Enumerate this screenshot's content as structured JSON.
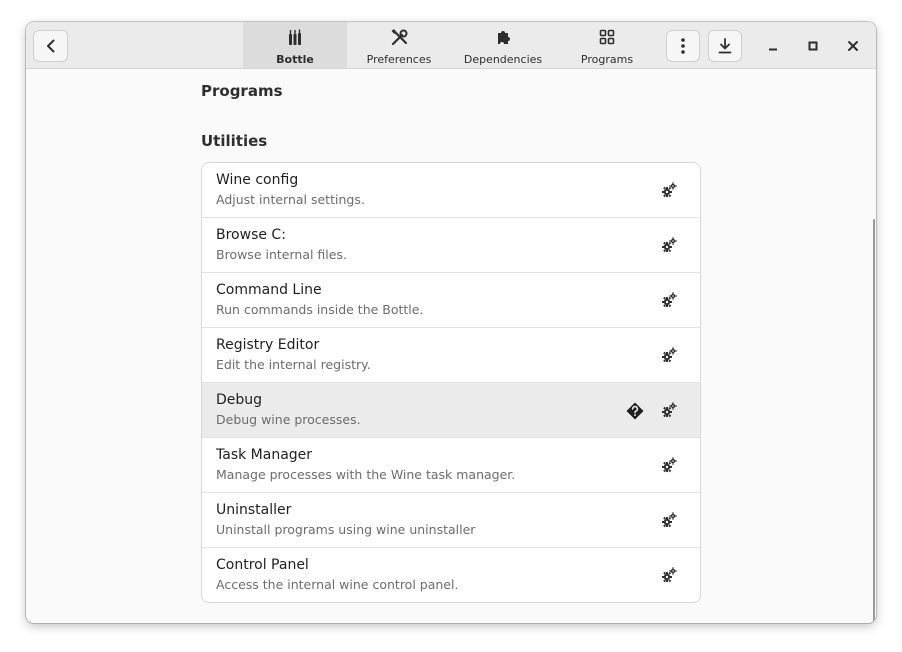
{
  "header": {
    "tabs": [
      {
        "label": "Bottle",
        "icon": "bottles-icon",
        "active": true
      },
      {
        "label": "Preferences",
        "icon": "preferences-icon",
        "active": false
      },
      {
        "label": "Dependencies",
        "icon": "puzzle-icon",
        "active": false
      },
      {
        "label": "Programs",
        "icon": "grid-icon",
        "active": false
      }
    ],
    "buttons": {
      "back": "back-arrow-icon",
      "menu": "kebab-menu-icon",
      "download": "download-icon",
      "minimize": "minimize-icon",
      "maximize": "maximize-icon",
      "close": "close-icon"
    }
  },
  "main": {
    "programs_title": "Programs",
    "utilities_title": "Utilities",
    "utilities": [
      {
        "title": "Wine config",
        "subtitle": "Adjust internal settings."
      },
      {
        "title": "Browse C:",
        "subtitle": "Browse internal files."
      },
      {
        "title": "Command Line",
        "subtitle": "Run commands inside the Bottle."
      },
      {
        "title": "Registry Editor",
        "subtitle": "Edit the internal registry."
      },
      {
        "title": "Debug",
        "subtitle": "Debug wine processes.",
        "help_glyph": "�"
      },
      {
        "title": "Task Manager",
        "subtitle": "Manage processes with the Wine task manager."
      },
      {
        "title": "Uninstaller",
        "subtitle": "Uninstall programs using wine uninstaller"
      },
      {
        "title": "Control Panel",
        "subtitle": "Access the internal wine control panel."
      }
    ]
  },
  "colors": {
    "window_bg": "#fafafa",
    "headerbar_bg": "#ebebeb",
    "active_tab_bg": "#dcdcdc",
    "row_hover_bg": "#ebebeb"
  }
}
